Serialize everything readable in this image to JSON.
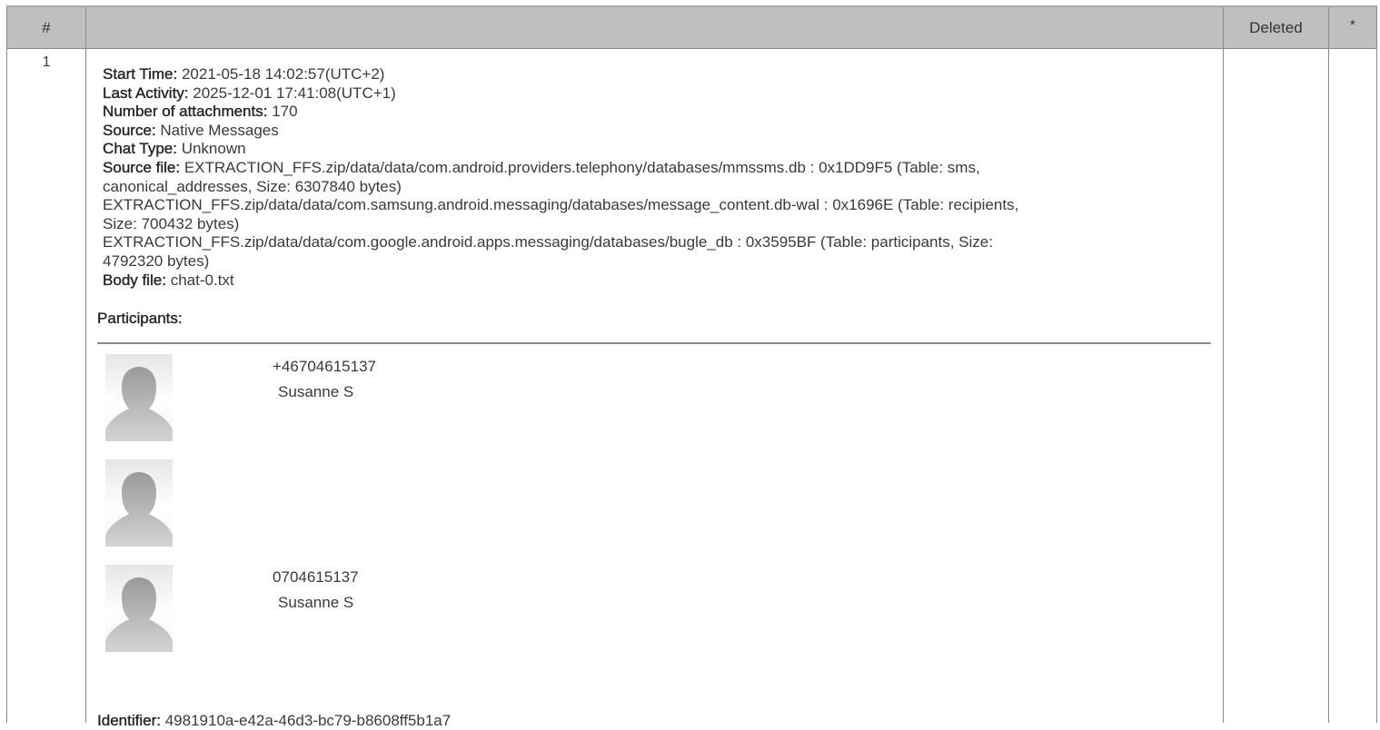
{
  "table": {
    "headers": {
      "index": "#",
      "main": "",
      "deleted": "Deleted",
      "star": "*"
    }
  },
  "row": {
    "index": "1",
    "start_time_label": "Start Time:",
    "start_time": "2021-05-18 14:02:57(UTC+2)",
    "last_activity_label": "Last Activity:",
    "last_activity": "2025-12-01 17:41:08(UTC+1)",
    "attachments_label": "Number of attachments:",
    "attachments": "170",
    "source_label": "Source:",
    "source": "Native Messages",
    "chat_type_label": "Chat Type:",
    "chat_type": "Unknown",
    "source_file_label": "Source file:",
    "source_file_1a": "EXTRACTION_FFS.zip/data/data/com.android.providers.telephony/databases/mmssms.db : 0x1DD9F5 (Table: sms,",
    "source_file_1b": "canonical_addresses, Size: 6307840 bytes)",
    "source_file_2a": "EXTRACTION_FFS.zip/data/data/com.samsung.android.messaging/databases/message_content.db-wal : 0x1696E (Table: recipients,",
    "source_file_2b": "Size: 700432 bytes)",
    "source_file_3a": "EXTRACTION_FFS.zip/data/data/com.google.android.apps.messaging/databases/bugle_db : 0x3595BF (Table: participants, Size:",
    "source_file_3b": "4792320 bytes)",
    "body_file_label": "Body file:",
    "body_file": "chat-0.txt",
    "participants_label": "Participants:",
    "participants": [
      {
        "phone": "+46704615137",
        "name": "Susanne S",
        "avatar_icon": "person-silhouette-icon"
      },
      {
        "phone": "",
        "name": "",
        "avatar_icon": "person-silhouette-icon"
      },
      {
        "phone": "0704615137",
        "name": "Susanne S",
        "avatar_icon": "person-silhouette-icon"
      }
    ],
    "identifier_label": "Identifier:",
    "identifier": "4981910a-e42a-46d3-bc79-b8608ff5b1a7",
    "deleted": "",
    "star": ""
  }
}
